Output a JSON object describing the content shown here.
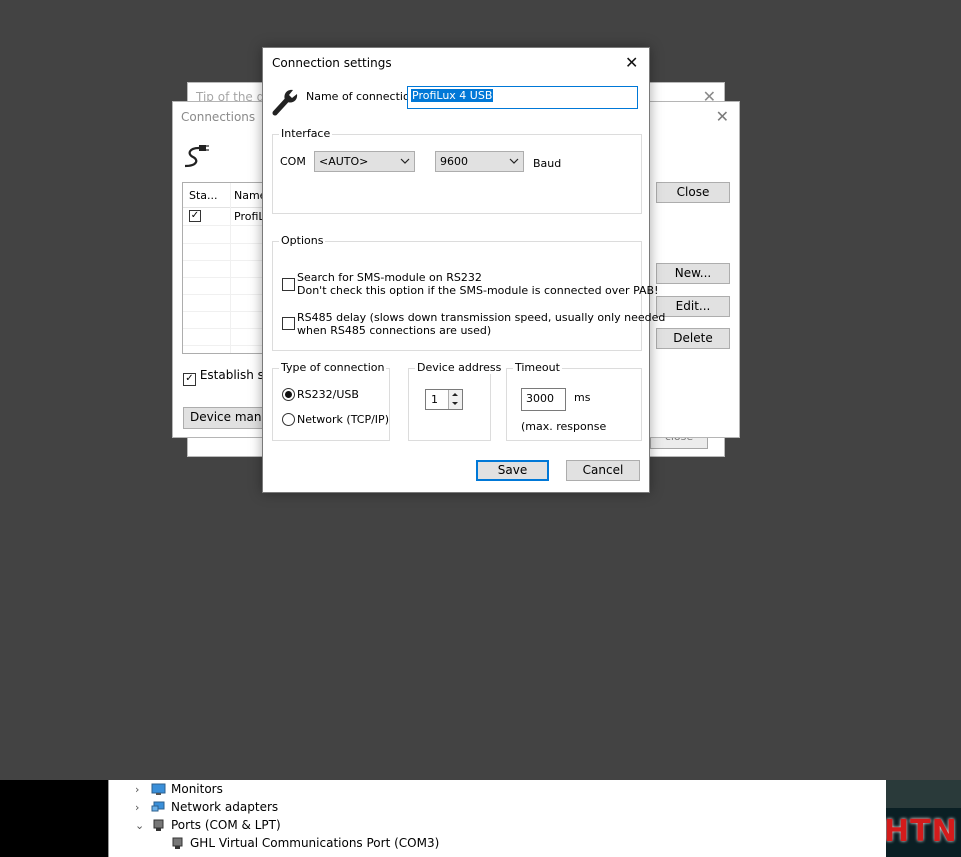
{
  "tip_window": {
    "title": "Tip of the day",
    "close_glyph": "✕",
    "ghost_button": "close"
  },
  "connections_window": {
    "title": "Connections",
    "close_glyph": "✕",
    "list": {
      "headers": [
        "Sta...",
        "Name"
      ],
      "rows": [
        {
          "checked": true,
          "name": "ProfiL"
        }
      ]
    },
    "establish_label": "Establish stan",
    "establish_checked": true,
    "device_manager_label": "Device manage",
    "buttons": {
      "close": "Close",
      "new": "New...",
      "edit": "Edit...",
      "delete": "Delete"
    }
  },
  "dialog": {
    "title": "Connection settings",
    "close_glyph": "✕",
    "name_label": "Name of connection",
    "name_value": "ProfiLux 4 USB",
    "interface": {
      "title": "Interface",
      "com_label": "COM",
      "com_value": "<AUTO>",
      "baud_value": "9600",
      "baud_label": "Baud"
    },
    "options": {
      "title": "Options",
      "sms_line1": "Search for SMS-module on RS232",
      "sms_line2": "Don't check this option if the SMS-module is connected over PAB!",
      "sms_checked": false,
      "rs485_line1": "RS485 delay (slows down transmission speed, usually only needed",
      "rs485_line2": "when RS485 connections are used)",
      "rs485_checked": false
    },
    "type_of_connection": {
      "title": "Type of connection",
      "rs232": "RS232/USB",
      "network": "Network (TCP/IP)",
      "selected": "RS232/USB"
    },
    "device_address": {
      "title": "Device address",
      "value": "1"
    },
    "timeout": {
      "title": "Timeout",
      "value": "3000",
      "unit": "ms",
      "note": "(max. response"
    },
    "buttons": {
      "save": "Save",
      "cancel": "Cancel"
    }
  },
  "device_manager": {
    "items": [
      {
        "label": "Monitors",
        "expanded": false,
        "icon": "monitor-icon"
      },
      {
        "label": "Network adapters",
        "expanded": false,
        "icon": "network-adapter-icon"
      },
      {
        "label": "Ports (COM & LPT)",
        "expanded": true,
        "icon": "port-icon"
      },
      {
        "label": "GHL Virtual Communications Port (COM3)",
        "child": true,
        "icon": "port-icon"
      }
    ]
  },
  "background_art_text": "HTN",
  "colors": {
    "desktop": "#434343",
    "accent": "#0078d7",
    "button": "#e1e1e1"
  }
}
